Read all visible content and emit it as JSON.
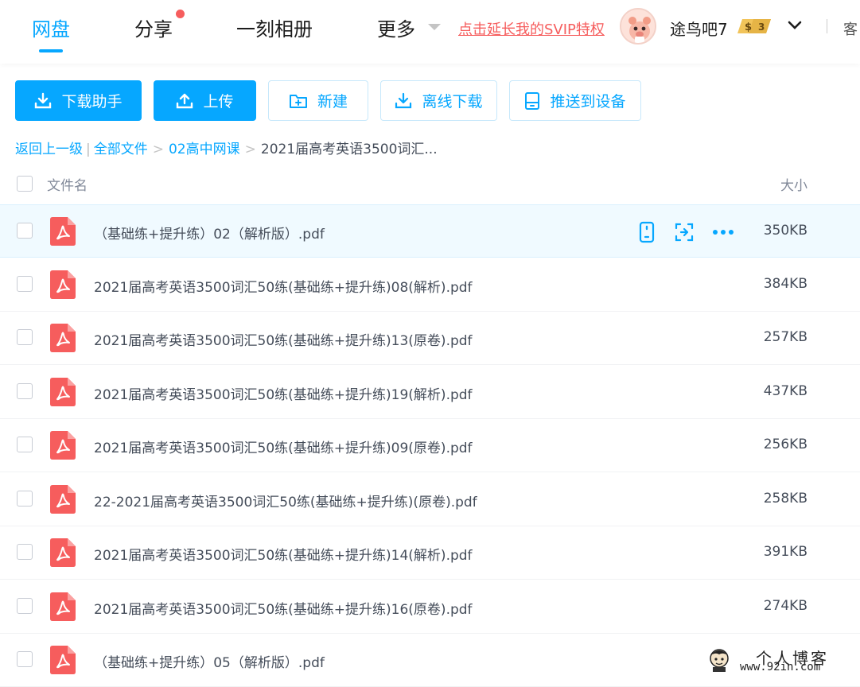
{
  "nav": {
    "items": [
      {
        "label": "网盘",
        "active": true
      },
      {
        "label": "分享",
        "active": false
      },
      {
        "label": "一刻相册",
        "active": false
      },
      {
        "label": "更多",
        "active": false
      }
    ],
    "svip_link": "点击延长我的SVIP特权",
    "username": "途鸟吧7",
    "vip_badge_text": "$",
    "vip_level": "3",
    "client_label": "客",
    "accent_color": "#06a7ff",
    "alert_color": "#f65d5d"
  },
  "toolbar": {
    "download_helper": "下载助手",
    "upload": "上传",
    "new_folder": "新建",
    "offline_download": "离线下载",
    "push_to_device": "推送到设备"
  },
  "breadcrumb": {
    "back": "返回上一级",
    "divider": "|",
    "all_files": "全部文件",
    "folder": "02高中网课",
    "current": "2021届高考英语3500词汇...",
    "sep": ">"
  },
  "table": {
    "col_name": "文件名",
    "col_size": "大小",
    "rows": [
      {
        "name": "（基础练+提升练）02（解析版）.pdf",
        "size": "350KB"
      },
      {
        "name": "2021届高考英语3500词汇50练(基础练+提升练)08(解析).pdf",
        "size": "384KB"
      },
      {
        "name": "2021届高考英语3500词汇50练(基础练+提升练)13(原卷).pdf",
        "size": "257KB"
      },
      {
        "name": "2021届高考英语3500词汇50练(基础练+提升练)19(解析).pdf",
        "size": "437KB"
      },
      {
        "name": "2021届高考英语3500词汇50练(基础练+提升练)09(原卷).pdf",
        "size": "256KB"
      },
      {
        "name": "22-2021届高考英语3500词汇50练(基础练+提升练)(原卷).pdf",
        "size": "258KB"
      },
      {
        "name": "2021届高考英语3500词汇50练(基础练+提升练)14(解析).pdf",
        "size": "391KB"
      },
      {
        "name": "2021届高考英语3500词汇50练(基础练+提升练)16(原卷).pdf",
        "size": "274KB"
      },
      {
        "name": "（基础练+提升练）05（解析版）.pdf",
        "size": ""
      }
    ]
  },
  "watermark": {
    "title": "个人博客",
    "url": "www.92in.com"
  }
}
